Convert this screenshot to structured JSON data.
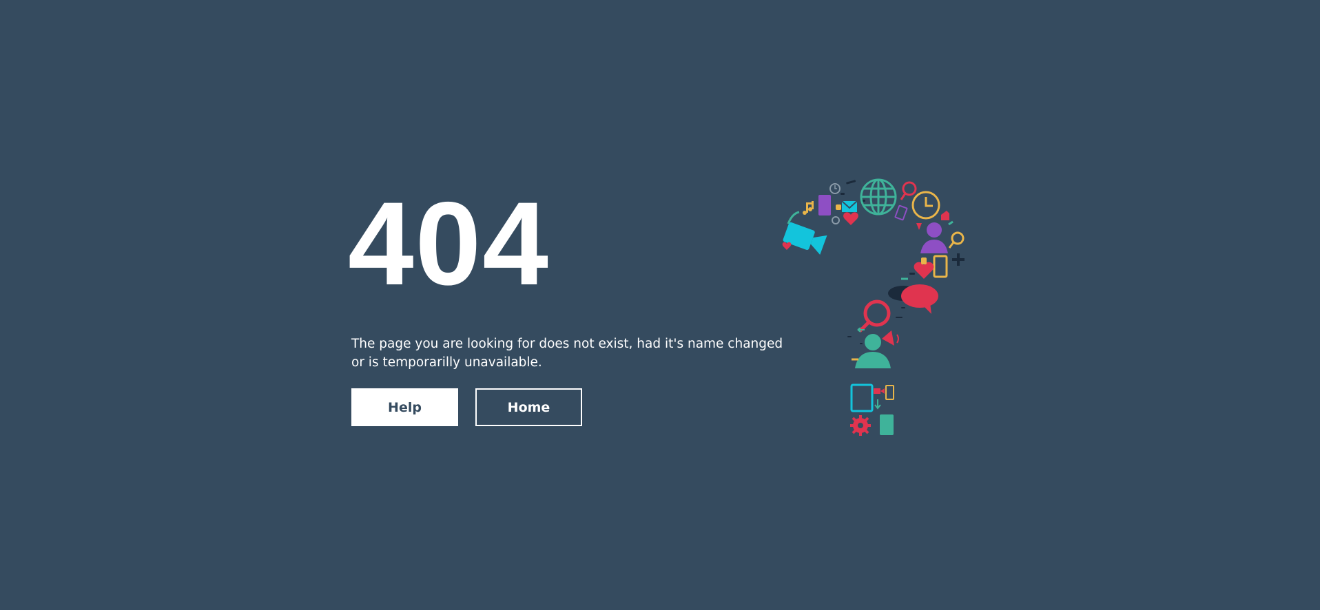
{
  "error": {
    "code": "404",
    "message": "The page you are looking for does not exist, had it's name changed or is temporarilly unavailable."
  },
  "actions": {
    "help_label": "Help",
    "home_label": "Home"
  },
  "colors": {
    "background": "#354b5f",
    "text": "#ffffff",
    "accent_red": "#e0344f",
    "accent_teal": "#3fb39a",
    "accent_cyan": "#13c4dc",
    "accent_purple": "#8e4fc4",
    "accent_yellow": "#e9b54a",
    "accent_navy": "#1b2a3b"
  },
  "illustration": {
    "icons": [
      "globe-icon",
      "clock-icon",
      "magnifier-icon",
      "video-camera-icon",
      "envelope-icon",
      "heart-icon",
      "person-icon",
      "phone-icon",
      "speech-bubble-icon",
      "megaphone-icon",
      "tablet-icon",
      "gear-icon",
      "plus-icon",
      "music-note-icon",
      "thumbs-up-icon",
      "document-icon"
    ]
  }
}
